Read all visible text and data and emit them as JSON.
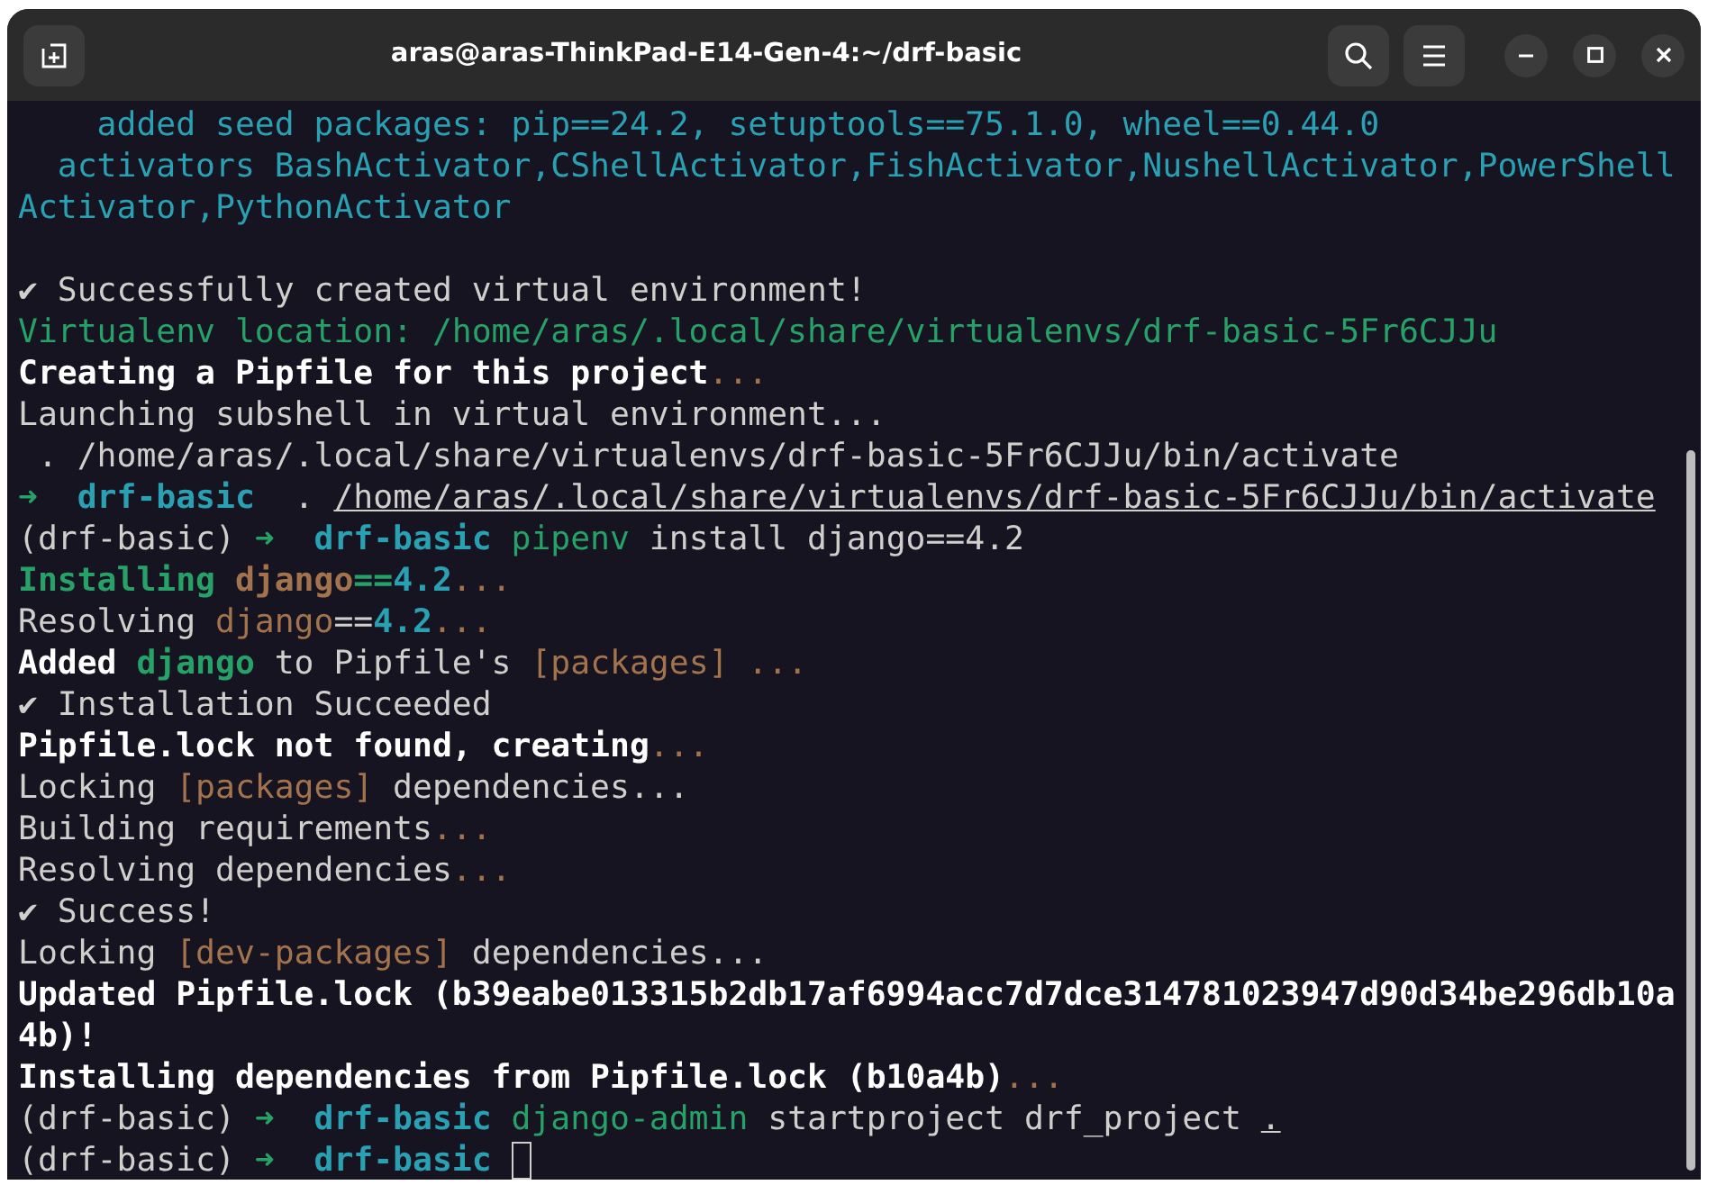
{
  "window": {
    "title": "aras@aras-ThinkPad-E14-Gen-4:~/drf-basic"
  },
  "terminal": {
    "cursor_visible": true,
    "lines": [
      {
        "kind": "output",
        "segments": [
          {
            "text": "    added seed packages: pip==24.2, setuptools==75.1.0, wheel==0.44.0",
            "kind": "cyan"
          }
        ]
      },
      {
        "kind": "output",
        "segments": [
          {
            "text": "  activators BashActivator,CShellActivator,FishActivator,NushellActivator,PowerShell",
            "kind": "cyan"
          }
        ]
      },
      {
        "kind": "output",
        "segments": [
          {
            "text": "Activator,PythonActivator",
            "kind": "cyan"
          }
        ]
      },
      {
        "kind": "blank"
      },
      {
        "kind": "output",
        "segments": [
          {
            "text": "✔ Successfully created virtual environment!",
            "kind": "plain"
          }
        ]
      },
      {
        "kind": "output",
        "segments": [
          {
            "text": "Virtualenv location: /home/aras/.local/share/virtualenvs/drf-basic-5Fr6CJJu",
            "kind": "green"
          }
        ]
      },
      {
        "kind": "output",
        "segments": [
          {
            "text": "Creating a Pipfile for this project",
            "kind": "bold"
          },
          {
            "text": "...",
            "kind": "brown"
          }
        ]
      },
      {
        "kind": "output",
        "segments": [
          {
            "text": "Launching subshell in virtual environment...",
            "kind": "plain"
          }
        ]
      },
      {
        "kind": "output",
        "segments": [
          {
            "text": " . /home/aras/.local/share/virtualenvs/drf-basic-5Fr6CJJu/bin/activate",
            "kind": "plain"
          }
        ]
      },
      {
        "kind": "output",
        "segments": [
          {
            "text": "➜",
            "kind": "green"
          },
          {
            "text": "  drf-basic",
            "kind": "boldcyan"
          },
          {
            "text": "  . ",
            "kind": "plain"
          },
          {
            "text": "/home/aras/.local/share/virtualenvs/drf-basic-5Fr6CJJu/bin/activate",
            "kind": "underline"
          }
        ]
      },
      {
        "kind": "output",
        "segments": [
          {
            "text": "(drf-basic) ",
            "kind": "plain"
          },
          {
            "text": "➜",
            "kind": "green"
          },
          {
            "text": "  drf-basic",
            "kind": "boldcyan"
          },
          {
            "text": " pipenv",
            "kind": "green"
          },
          {
            "text": " install django==4.2",
            "kind": "plain"
          }
        ]
      },
      {
        "kind": "output",
        "segments": [
          {
            "text": "Installing ",
            "kind": "boldgreen"
          },
          {
            "text": "django",
            "kind": "boldbrown"
          },
          {
            "text": "==",
            "kind": "boldgreen"
          },
          {
            "text": "4.2",
            "kind": "boldcyan"
          },
          {
            "text": "...",
            "kind": "brown"
          }
        ]
      },
      {
        "kind": "output",
        "segments": [
          {
            "text": "Resolving ",
            "kind": "plain"
          },
          {
            "text": "django",
            "kind": "brown"
          },
          {
            "text": "==",
            "kind": "plain"
          },
          {
            "text": "4.2",
            "kind": "boldcyan"
          },
          {
            "text": "...",
            "kind": "brown"
          }
        ]
      },
      {
        "kind": "output",
        "segments": [
          {
            "text": "Added ",
            "kind": "bold"
          },
          {
            "text": "django",
            "kind": "boldgreen"
          },
          {
            "text": " to Pipfile's ",
            "kind": "plain"
          },
          {
            "text": "[packages]",
            "kind": "brown"
          },
          {
            "text": " ...",
            "kind": "brown"
          }
        ]
      },
      {
        "kind": "output",
        "segments": [
          {
            "text": "✔ Installation Succeeded",
            "kind": "plain"
          }
        ]
      },
      {
        "kind": "output",
        "segments": [
          {
            "text": "Pipfile.lock not found, creating",
            "kind": "bold"
          },
          {
            "text": "...",
            "kind": "brown"
          }
        ]
      },
      {
        "kind": "output",
        "segments": [
          {
            "text": "Locking ",
            "kind": "plain"
          },
          {
            "text": "[packages]",
            "kind": "brown"
          },
          {
            "text": " dependencies...",
            "kind": "plain"
          }
        ]
      },
      {
        "kind": "output",
        "segments": [
          {
            "text": "Building requirements",
            "kind": "plain"
          },
          {
            "text": "...",
            "kind": "brown"
          }
        ]
      },
      {
        "kind": "output",
        "segments": [
          {
            "text": "Resolving dependencies",
            "kind": "plain"
          },
          {
            "text": "...",
            "kind": "brown"
          }
        ]
      },
      {
        "kind": "output",
        "segments": [
          {
            "text": "✔ Success!",
            "kind": "plain"
          }
        ]
      },
      {
        "kind": "output",
        "segments": [
          {
            "text": "Locking ",
            "kind": "plain"
          },
          {
            "text": "[dev-packages]",
            "kind": "brown"
          },
          {
            "text": " dependencies...",
            "kind": "plain"
          }
        ]
      },
      {
        "kind": "output",
        "segments": [
          {
            "text": "Updated Pipfile.lock (b39eabe013315b2db17af6994acc7d7dce314781023947d90d34be296db10a",
            "kind": "bold"
          }
        ]
      },
      {
        "kind": "output",
        "segments": [
          {
            "text": "4b)!",
            "kind": "bold"
          }
        ]
      },
      {
        "kind": "output",
        "segments": [
          {
            "text": "Installing dependencies from Pipfile.lock (b10a4b)",
            "kind": "bold"
          },
          {
            "text": "...",
            "kind": "brown"
          }
        ]
      },
      {
        "kind": "output",
        "segments": [
          {
            "text": "(drf-basic) ",
            "kind": "plain"
          },
          {
            "text": "➜",
            "kind": "green"
          },
          {
            "text": "  drf-basic",
            "kind": "boldcyan"
          },
          {
            "text": " django-admin",
            "kind": "green"
          },
          {
            "text": " startproject drf_project ",
            "kind": "plain"
          },
          {
            "text": ".",
            "kind": "underline"
          }
        ]
      },
      {
        "kind": "output",
        "segments": [
          {
            "text": "(drf-basic) ",
            "kind": "plain"
          },
          {
            "text": "➜",
            "kind": "green"
          },
          {
            "text": "  drf-basic",
            "kind": "boldcyan"
          }
        ]
      }
    ]
  }
}
